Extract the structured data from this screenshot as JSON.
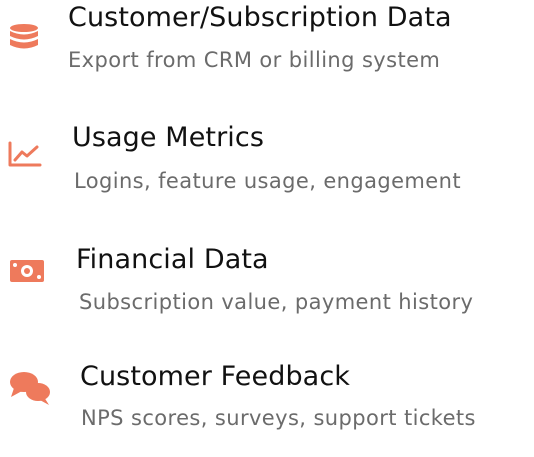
{
  "theme": {
    "icon_color": "#ee7a5c",
    "title_color": "#111111",
    "description_color": "#6b6b6b"
  },
  "sources": [
    {
      "icon": "database-icon",
      "title": "Customer/Subscription Data",
      "description": "Export from CRM or billing system"
    },
    {
      "icon": "line-chart-icon",
      "title": "Usage Metrics",
      "description": "Logins, feature usage, engagement"
    },
    {
      "icon": "money-bill-icon",
      "title": "Financial Data",
      "description": "Subscription value, payment history"
    },
    {
      "icon": "comments-icon",
      "title": "Customer Feedback",
      "description": "NPS scores, surveys, support tickets"
    }
  ]
}
